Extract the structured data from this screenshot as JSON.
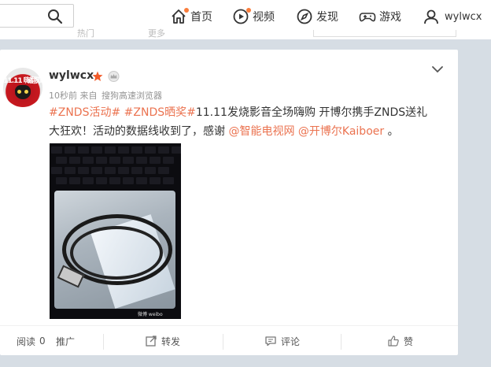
{
  "nav": {
    "home": "首页",
    "video": "视频",
    "discover": "发现",
    "game": "游戏",
    "user": "wylwcx"
  },
  "strip": {
    "a": "热门",
    "b": "更多"
  },
  "post": {
    "avatar_text": "11.11 嗨翻双十一",
    "username": "wylwcx",
    "time": "10秒前",
    "from_label": "来自",
    "source": "搜狗高速浏览器",
    "tag1": "#ZNDS活动#",
    "tag2": "#ZNDS晒奖#",
    "text1": "11.11发烧影音全场嗨购 开博尔携手ZNDS送礼大狂欢！活动的数据线收到了，感谢",
    "mention1": "@智能电视网",
    "mention2": "@开博尔Kaiboer",
    "text_end": "。",
    "watermark": "微博 weibo"
  },
  "actions": {
    "read_label": "阅读",
    "read_count": "0",
    "promote": "推广",
    "repost": "转发",
    "comment": "评论",
    "like": "赞"
  },
  "colors": {
    "accent": "#eb7350",
    "nav_dot": "#fa7d3c",
    "page_bg": "#d6dde4"
  }
}
